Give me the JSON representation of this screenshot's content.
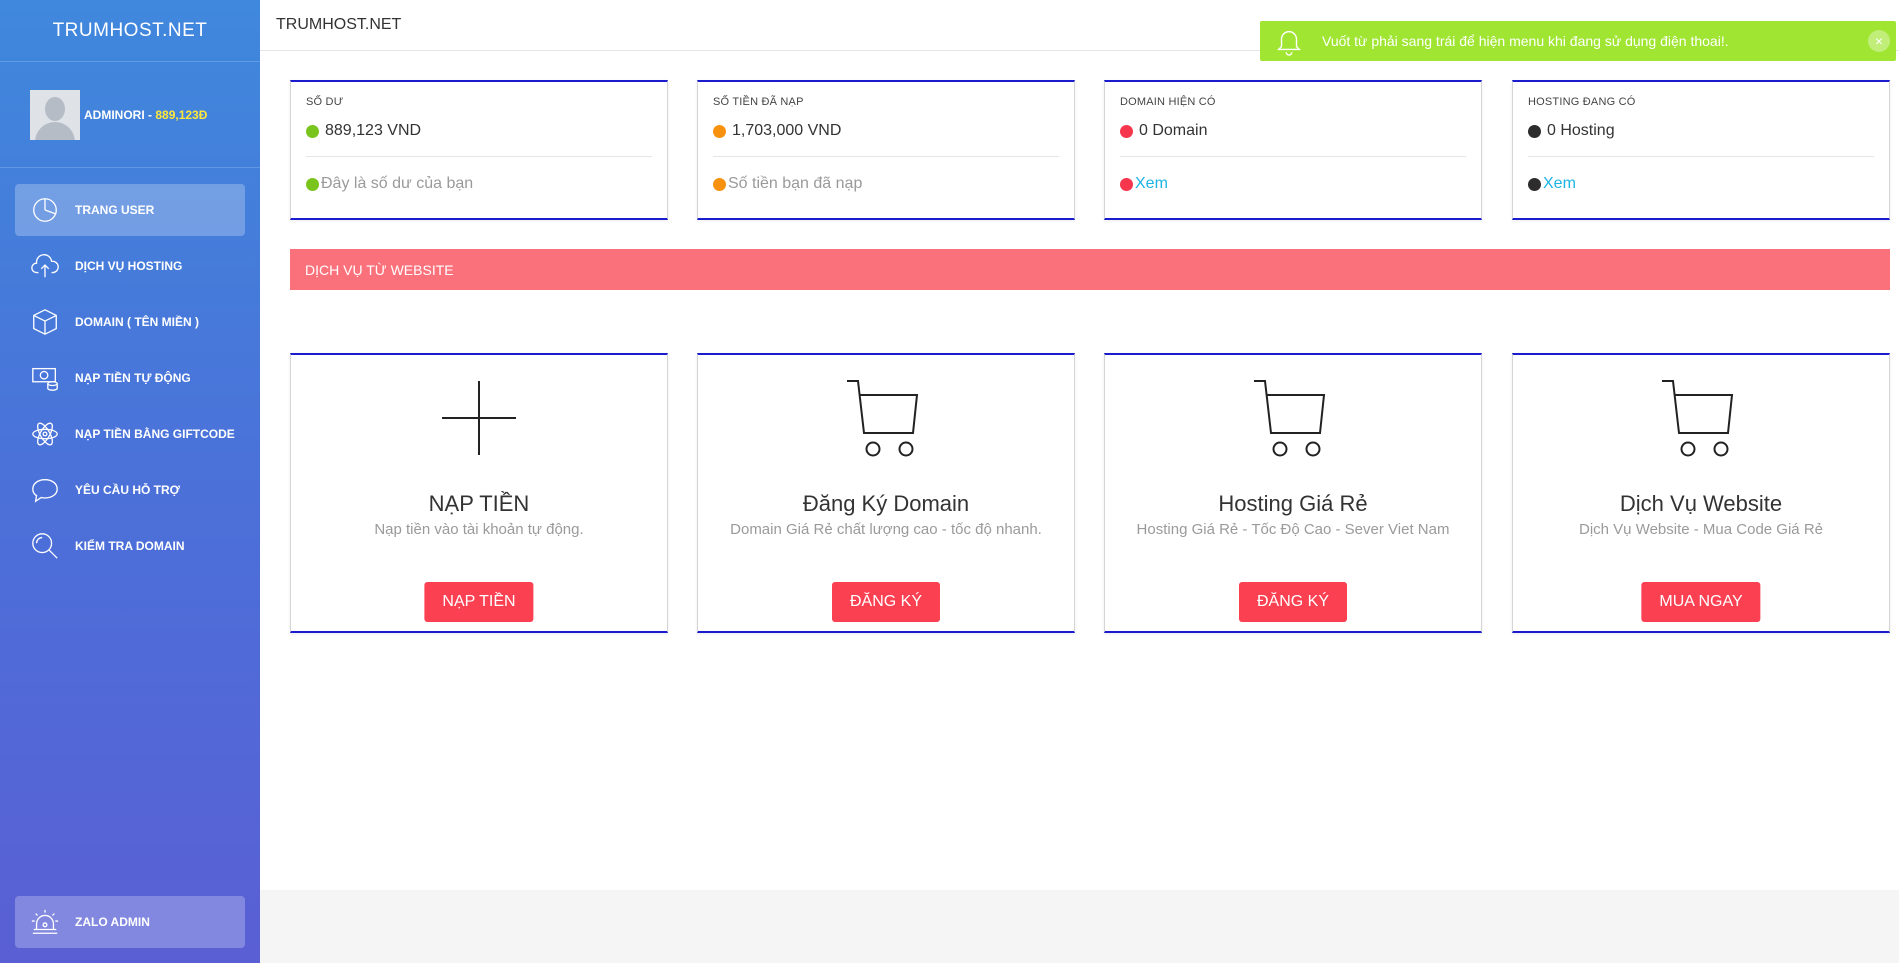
{
  "sidebar": {
    "brand": "TRUMHOST.NET",
    "user": {
      "name": "ADMINORI -",
      "balance": "889,123Đ"
    },
    "items": [
      {
        "label": "TRANG USER",
        "icon": "pie-chart-icon",
        "active": true
      },
      {
        "label": "DỊCH VỤ HOSTING",
        "icon": "cloud-upload-icon"
      },
      {
        "label": "DOMAIN ( TÊN MIỀN )",
        "icon": "box-icon"
      },
      {
        "label": "NẠP TIỀN TỰ ĐỘNG",
        "icon": "money-icon"
      },
      {
        "label": "NẠP TIỀN BẰNG GIFTCODE",
        "icon": "atom-icon"
      },
      {
        "label": "YÊU CẦU HỖ TRỢ",
        "icon": "chat-bubble-icon"
      },
      {
        "label": "KIỂM TRA DOMAIN",
        "icon": "search-icon"
      }
    ],
    "zalo": {
      "label": "ZALO ADMIN",
      "icon": "alarm-icon"
    }
  },
  "topbar": {
    "title": "TRUMHOST.NET"
  },
  "notification": {
    "text": "Vuốt từ phải sang trái để hiện menu khi đang sử dụng điện thoai!.",
    "icon": "bell-icon",
    "close": "×"
  },
  "stats": [
    {
      "title": "SỐ DƯ",
      "value": "889,123 VND",
      "footer": "Đây là số dư của bạn",
      "color": "#7ac51d",
      "link": false
    },
    {
      "title": "SỐ TIỀN ĐÃ NẠP",
      "value": "1,703,000 VND",
      "footer": "Số tiền bạn đã nạp",
      "color": "#f8920e",
      "link": false
    },
    {
      "title": "DOMAIN HIỆN CÓ",
      "value": "0 Domain",
      "footer": "Xem",
      "color": "#f5364c",
      "link": true
    },
    {
      "title": "HOSTING ĐANG CÓ",
      "value": "0 Hosting",
      "footer": "Xem",
      "color": "#2d2d2d",
      "link": true
    }
  ],
  "banner": {
    "text": "DỊCH VỤ TỪ WEBSITE"
  },
  "services": [
    {
      "title": "NẠP TIỀN",
      "desc": "Nạp tiền vào tài khoản tự động.",
      "button": "NẠP TIỀN",
      "icon": "plus-icon"
    },
    {
      "title": "Đăng Ký Domain",
      "desc": "Domain Giá Rẻ chất lượng cao - tốc độ nhanh.",
      "button": "ĐĂNG KÝ",
      "icon": "cart-icon"
    },
    {
      "title": "Hosting Giá Rẻ",
      "desc": "Hosting Giá Rẻ - Tốc Độ Cao - Sever Viet Nam",
      "button": "ĐĂNG KÝ",
      "icon": "cart-icon"
    },
    {
      "title": "Dịch Vụ Website",
      "desc": "Dịch Vụ Website - Mua Code Giá Rẻ",
      "button": "MUA NGAY",
      "icon": "cart-icon"
    }
  ],
  "colors": {
    "sidebar_top": "#3f88dd",
    "sidebar_bottom": "#5a5fd4",
    "banner": "#fb717b",
    "button": "#fa4051",
    "notification": "#9fe531",
    "card_border": "#1c1ccf"
  }
}
